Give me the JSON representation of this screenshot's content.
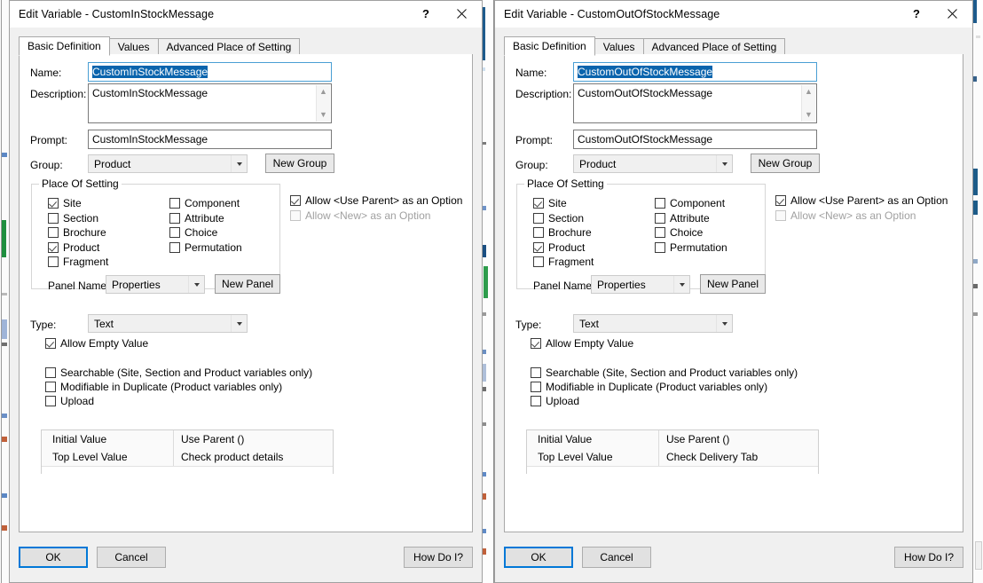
{
  "background": {
    "left_sliver_name": "background-window-left",
    "mid_sliver_name": "background-window-middle",
    "right_sliver_name": "background-window-right"
  },
  "colors": {
    "accent": "#0078d7",
    "selection": "#0a64ad",
    "focus_border": "#4a9fd4",
    "window_bg": "#f0f0f0",
    "page_bg": "#ffffff"
  },
  "windows": [
    {
      "id": "left",
      "title": "Edit Variable - CustomInStockMessage",
      "titlebar": {
        "help_label": "?",
        "close_label": "✕"
      },
      "tabs": [
        {
          "label": "Basic Definition",
          "active": true
        },
        {
          "label": "Values",
          "active": false
        },
        {
          "label": "Advanced Place of Setting",
          "active": false
        }
      ],
      "fields": {
        "name_label": "Name:",
        "name_value": "CustomInStockMessage",
        "description_label": "Description:",
        "description_value": "CustomInStockMessage",
        "prompt_label": "Prompt:",
        "prompt_value": "CustomInStockMessage",
        "group_label": "Group:",
        "group_value": "Product",
        "new_group_button": "New Group",
        "type_label": "Type:",
        "type_value": "Text"
      },
      "place_of_setting": {
        "title": "Place Of Setting",
        "column1": [
          {
            "label": "Site",
            "checked": true
          },
          {
            "label": "Section",
            "checked": false
          },
          {
            "label": "Brochure",
            "checked": false
          },
          {
            "label": "Product",
            "checked": true
          },
          {
            "label": "Fragment",
            "checked": false
          }
        ],
        "column2": [
          {
            "label": "Component",
            "checked": false
          },
          {
            "label": "Attribute",
            "checked": false
          },
          {
            "label": "Choice",
            "checked": false
          },
          {
            "label": "Permutation",
            "checked": false
          }
        ],
        "panel_name_label": "Panel Name:",
        "panel_name_value": "Properties",
        "new_panel_button": "New Panel"
      },
      "options": {
        "allow_use_parent": {
          "label": "Allow <Use Parent> as an Option",
          "checked": true,
          "disabled": false
        },
        "allow_new": {
          "label": "Allow <New> as an Option",
          "checked": false,
          "disabled": true
        },
        "allow_empty_value": {
          "label": "Allow Empty Value",
          "checked": true
        },
        "searchable": {
          "label": "Searchable (Site, Section and Product variables only)",
          "checked": false
        },
        "modifiable_in_duplicate": {
          "label": "Modifiable in Duplicate (Product variables only)",
          "checked": false
        },
        "upload": {
          "label": "Upload",
          "checked": false
        }
      },
      "value_grid": {
        "rows": [
          {
            "label": "Initial Value",
            "value": "Use Parent ()"
          },
          {
            "label": "Top Level Value",
            "value": "Check product details"
          }
        ]
      },
      "footer": {
        "ok": "OK",
        "cancel": "Cancel",
        "how_do_i": "How Do I?"
      }
    },
    {
      "id": "right",
      "title": "Edit Variable - CustomOutOfStockMessage",
      "titlebar": {
        "help_label": "?",
        "close_label": "✕"
      },
      "tabs": [
        {
          "label": "Basic Definition",
          "active": true
        },
        {
          "label": "Values",
          "active": false
        },
        {
          "label": "Advanced Place of Setting",
          "active": false
        }
      ],
      "fields": {
        "name_label": "Name:",
        "name_value": "CustomOutOfStockMessage",
        "description_label": "Description:",
        "description_value": "CustomOutOfStockMessage",
        "prompt_label": "Prompt:",
        "prompt_value": "CustomOutOfStockMessage",
        "group_label": "Group:",
        "group_value": "Product",
        "new_group_button": "New Group",
        "type_label": "Type:",
        "type_value": "Text"
      },
      "place_of_setting": {
        "title": "Place Of Setting",
        "column1": [
          {
            "label": "Site",
            "checked": true
          },
          {
            "label": "Section",
            "checked": false
          },
          {
            "label": "Brochure",
            "checked": false
          },
          {
            "label": "Product",
            "checked": true
          },
          {
            "label": "Fragment",
            "checked": false
          }
        ],
        "column2": [
          {
            "label": "Component",
            "checked": false
          },
          {
            "label": "Attribute",
            "checked": false
          },
          {
            "label": "Choice",
            "checked": false
          },
          {
            "label": "Permutation",
            "checked": false
          }
        ],
        "panel_name_label": "Panel Name:",
        "panel_name_value": "Properties",
        "new_panel_button": "New Panel"
      },
      "options": {
        "allow_use_parent": {
          "label": "Allow <Use Parent> as an Option",
          "checked": true,
          "disabled": false
        },
        "allow_new": {
          "label": "Allow <New> as an Option",
          "checked": false,
          "disabled": true
        },
        "allow_empty_value": {
          "label": "Allow Empty Value",
          "checked": true
        },
        "searchable": {
          "label": "Searchable (Site, Section and Product variables only)",
          "checked": false
        },
        "modifiable_in_duplicate": {
          "label": "Modifiable in Duplicate (Product variables only)",
          "checked": false
        },
        "upload": {
          "label": "Upload",
          "checked": false
        }
      },
      "value_grid": {
        "rows": [
          {
            "label": "Initial Value",
            "value": "Use Parent ()"
          },
          {
            "label": "Top Level Value",
            "value": "Check Delivery Tab"
          }
        ]
      },
      "footer": {
        "ok": "OK",
        "cancel": "Cancel",
        "how_do_i": "How Do I?"
      }
    }
  ]
}
